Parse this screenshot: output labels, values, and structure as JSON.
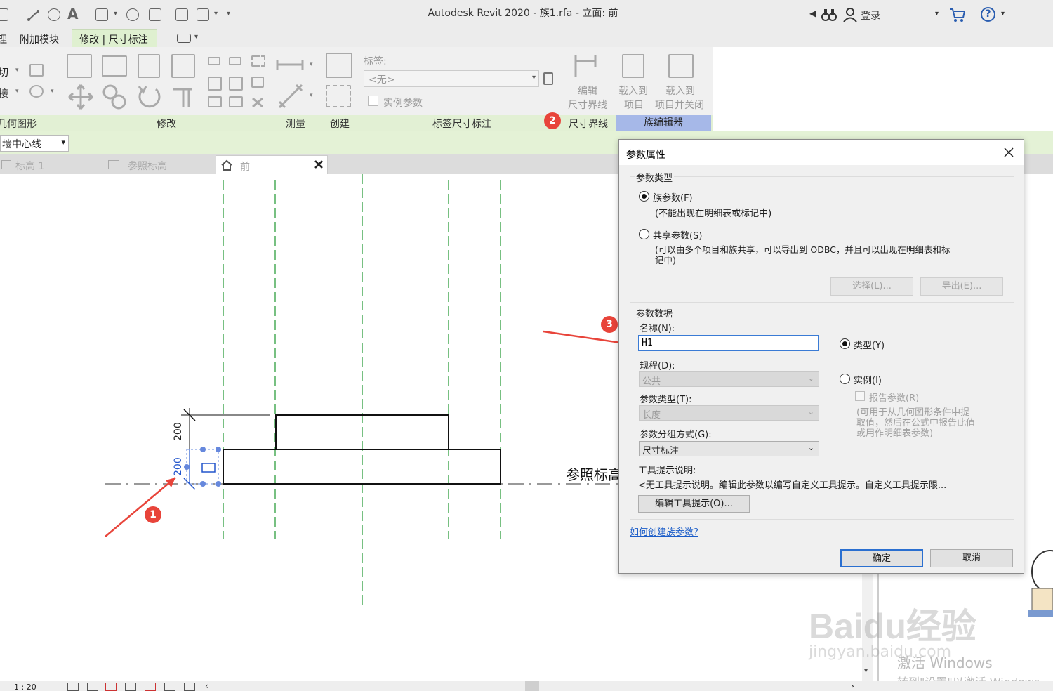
{
  "window": {
    "title": "Autodesk Revit 2020 - 族1.rfa - 立面: 前",
    "login": "登录"
  },
  "ribbon": {
    "tabs": [
      "附加模块",
      "修改 | 尺寸标注"
    ],
    "panels": {
      "geometry": "几何图形",
      "modify": "修改",
      "measure": "测量",
      "create": "创建",
      "label_dim": "标签尺寸标注",
      "witness": "尺寸界线",
      "family_editor": "族编辑器"
    },
    "label_caption": "标签:",
    "label_value": "<无>",
    "instance_param": "实例参数",
    "edit_witness": [
      "编辑",
      "尺寸界线"
    ],
    "load_project": [
      "载入到",
      "项目"
    ],
    "load_close": [
      "载入到",
      "项目并关闭"
    ],
    "left_partial": [
      "切",
      "接"
    ]
  },
  "options_bar": {
    "combo": "墙中心线"
  },
  "view_tabs": [
    "标高 1",
    "参照标高",
    "前"
  ],
  "canvas": {
    "dim_upper": "200",
    "dim_lower": "200",
    "ref_level_text": "参照标高"
  },
  "annotations": {
    "b1": "1",
    "b2": "2",
    "b3": "3"
  },
  "status": {
    "scale": "1 : 20"
  },
  "watermark": {
    "baidu": "Baidu经验",
    "url": "jingyan.baidu.com",
    "activate1": "激活 Windows",
    "activate2": "转到\"设置\"以激活 Windows"
  },
  "dialog": {
    "title": "参数属性",
    "param_type_group": "参数类型",
    "family_param": "族参数(F)",
    "family_param_note": "(不能出现在明细表或标记中)",
    "shared_param": "共享参数(S)",
    "shared_param_note1": "(可以由多个项目和族共享，可以导出到 ODBC，并且可以出现在明细表和标",
    "shared_param_note2": "记中)",
    "select_btn": "选择(L)...",
    "export_btn": "导出(E)...",
    "param_data_group": "参数数据",
    "name_label": "名称(N):",
    "name_value": "H1",
    "type_radio": "类型(Y)",
    "discipline_label": "规程(D):",
    "discipline_value": "公共",
    "instance_radio": "实例(I)",
    "param_type_label": "参数类型(T):",
    "param_type_value": "长度",
    "report_param": "报告参数(R)",
    "report_note1": "(可用于从几何图形条件中提",
    "report_note2": "取值，然后在公式中报告此值",
    "report_note3": "或用作明细表参数)",
    "group_label": "参数分组方式(G):",
    "group_value": "尺寸标注",
    "tooltip_label": "工具提示说明:",
    "tooltip_value": "<无工具提示说明。编辑此参数以编写自定义工具提示。自定义工具提示限...",
    "edit_tooltip_btn": "编辑工具提示(O)...",
    "help_link": "如何创建族参数?",
    "ok_btn": "确定",
    "cancel_btn": "取消"
  },
  "colors": {
    "ribbon_green": "#dff0d0",
    "family_editor": "#a6b8e8",
    "ref_plane": "#2e9e3e",
    "arrow_red": "#e8443a"
  }
}
